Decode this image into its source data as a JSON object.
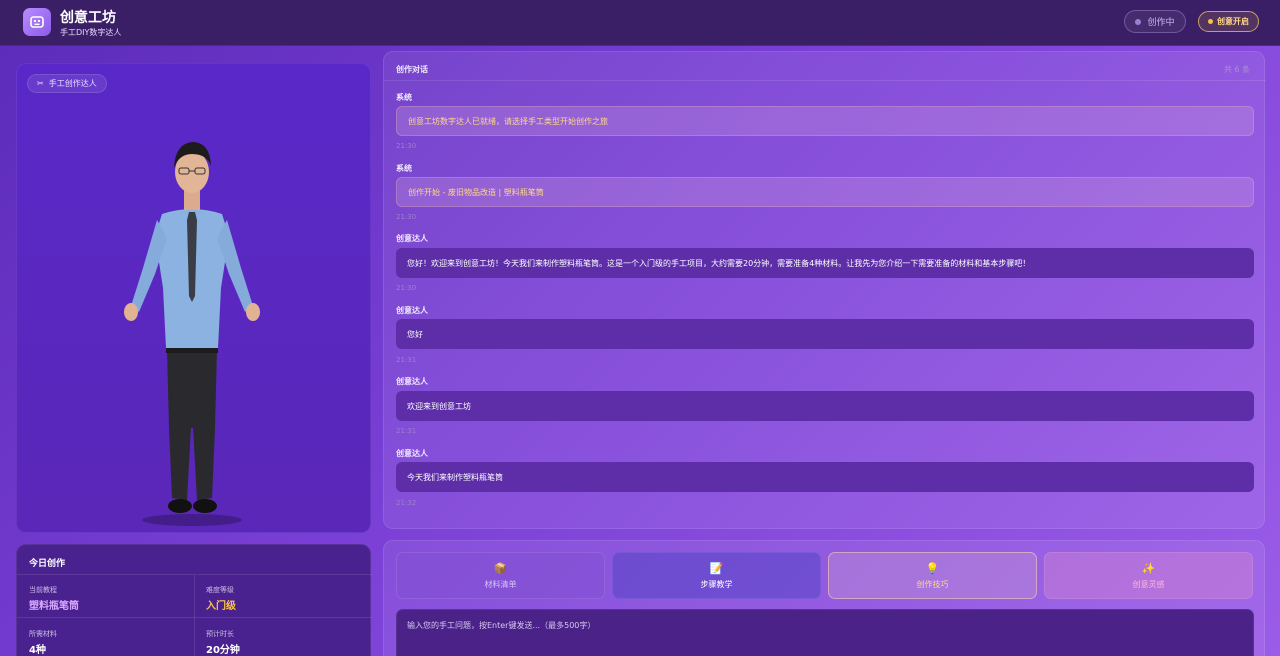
{
  "header": {
    "title": "创意工坊",
    "subtitle": "手工DIY数字达人",
    "status_label": "创作中",
    "start_label": "创意开启"
  },
  "avatar": {
    "tag_icon": "scissors-icon",
    "tag_label": "手工创作达人"
  },
  "today": {
    "title": "今日创作",
    "stats": [
      {
        "label": "当前教程",
        "value": "塑料瓶笔筒",
        "color": "#d9a8ff"
      },
      {
        "label": "难度等级",
        "value": "入门级",
        "color": "#ffc64a"
      },
      {
        "label": "所需材料",
        "value": "4种",
        "color": "#ffffff"
      },
      {
        "label": "预计时长",
        "value": "20分钟",
        "color": "#ffffff"
      }
    ]
  },
  "chat": {
    "title": "创作对话",
    "count": "共 6 条",
    "messages": [
      {
        "sender": "系统",
        "text": "创意工坊数字达人已就绪，请选择手工类型开始创作之旅",
        "time": "21:30",
        "kind": "system"
      },
      {
        "sender": "系统",
        "text": "创作开始 - 废旧物品改造 | 塑料瓶笔筒",
        "time": "21:30",
        "kind": "system"
      },
      {
        "sender": "创意达人",
        "text": "您好！欢迎来到创意工坊！今天我们来制作塑料瓶笔筒。这是一个入门级的手工项目，大约需要20分钟，需要准备4种材料。让我先为您介绍一下需要准备的材料和基本步骤吧！",
        "time": "21:30",
        "kind": "user"
      },
      {
        "sender": "创意达人",
        "text": "您好",
        "time": "21:31",
        "kind": "user"
      },
      {
        "sender": "创意达人",
        "text": "欢迎来到创意工坊",
        "time": "21:31",
        "kind": "user"
      },
      {
        "sender": "创意达人",
        "text": "今天我们来制作塑料瓶笔筒",
        "time": "21:32",
        "kind": "user"
      }
    ]
  },
  "actions": {
    "materials": {
      "icon": "📦",
      "label": "材料清单"
    },
    "steps": {
      "icon": "📝",
      "label": "步骤教学"
    },
    "tips": {
      "icon": "💡",
      "label": "创作技巧"
    },
    "inspire": {
      "icon": "✨",
      "label": "创意灵感"
    }
  },
  "input": {
    "placeholder": "输入您的手工问题，按Enter键发送...（最多500字）"
  }
}
